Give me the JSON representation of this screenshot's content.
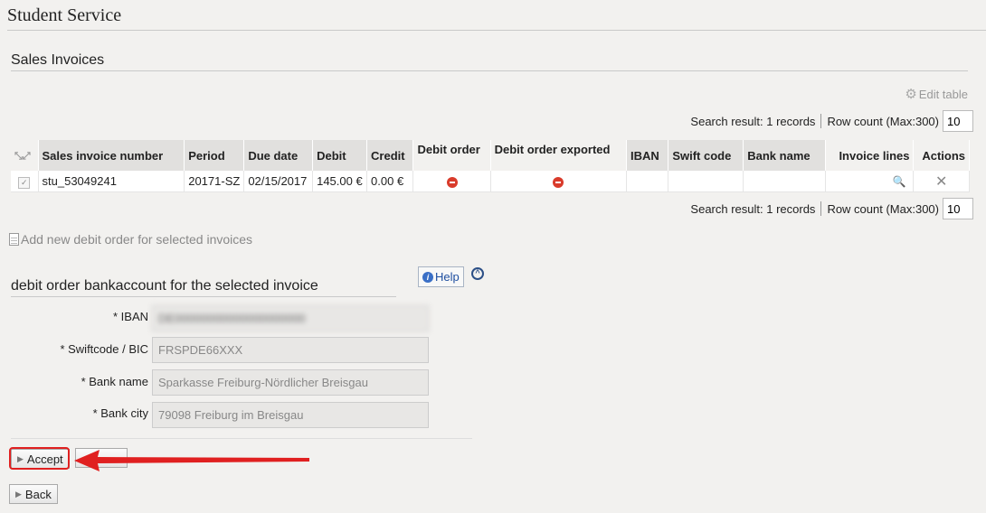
{
  "page_title": "Student Service",
  "section_title": "Sales Invoices",
  "edit_table_label": "Edit table",
  "search": {
    "result_label": "Search result: 1 records",
    "row_count_label": "Row count (Max:300)",
    "row_count_value": "10"
  },
  "table": {
    "headers": {
      "invoice_number": "Sales invoice number",
      "period": "Period",
      "due_date": "Due date",
      "debit": "Debit",
      "credit": "Credit",
      "debit_order": "Debit order",
      "debit_order_exported": "Debit order exported",
      "iban": "IBAN",
      "swift": "Swift code",
      "bank_name": "Bank name",
      "invoice_lines": "Invoice lines",
      "actions": "Actions"
    },
    "rows": [
      {
        "invoice_number": "stu_53049241",
        "period": "20171-SZ",
        "due_date": "02/15/2017",
        "debit": "145.00 €",
        "credit": "0.00 €",
        "iban": "",
        "swift": "",
        "bank_name": ""
      }
    ]
  },
  "add_debit_order_label": "Add new debit order for selected invoices",
  "help_label": "Help",
  "form": {
    "title": "debit order bankaccount for the selected invoice",
    "iban_label": "* IBAN",
    "iban_value": "DE00000000000000000000",
    "swift_label": "* Swiftcode / BIC",
    "swift_value": "FRSPDE66XXX",
    "bank_name_label": "* Bank name",
    "bank_name_value": "Sparkasse Freiburg-Nördlicher Breisgau",
    "bank_city_label": "* Bank city",
    "bank_city_value": "79098 Freiburg im Breisgau"
  },
  "buttons": {
    "accept": "Accept",
    "back": "Back"
  },
  "colors": {
    "highlight": "#e02020",
    "header_bg": "#e1e0de",
    "status_red": "#d93b2b"
  }
}
